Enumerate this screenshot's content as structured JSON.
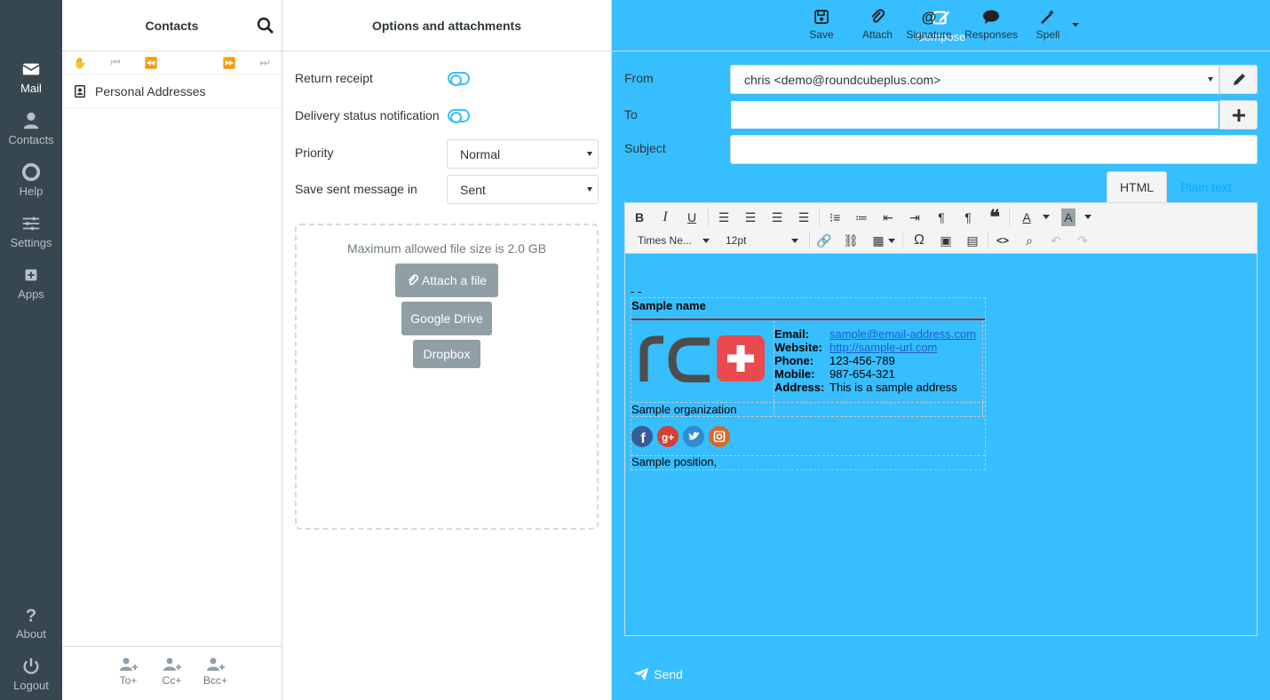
{
  "nav": {
    "compose": "Compose",
    "mail": "Mail",
    "contacts": "Contacts",
    "help": "Help",
    "settings": "Settings",
    "apps": "Apps",
    "about": "About",
    "logout": "Logout"
  },
  "contacts_panel": {
    "title": "Contacts",
    "address_book": "Personal Addresses",
    "to_plus": "To+",
    "cc_plus": "Cc+",
    "bcc_plus": "Bcc+"
  },
  "options": {
    "title": "Options and attachments",
    "return_receipt": "Return receipt",
    "delivery_status": "Delivery status notification",
    "priority_label": "Priority",
    "priority_value": "Normal",
    "save_sent_label": "Save sent message in",
    "save_sent_value": "Sent",
    "max_file_size": "Maximum allowed file size is 2.0 GB",
    "attach_file": "Attach a file",
    "google_drive": "Google Drive",
    "dropbox": "Dropbox"
  },
  "toolbar": {
    "save": "Save",
    "attach": "Attach",
    "signature": "Signature",
    "responses": "Responses",
    "spell": "Spell"
  },
  "headers": {
    "from_label": "From",
    "from_value": "chris <demo@roundcubeplus.com>",
    "to_label": "To",
    "to_value": "",
    "subject_label": "Subject",
    "subject_value": ""
  },
  "editor": {
    "tab_html": "HTML",
    "tab_plain": "Plain text",
    "font_family": "Times Ne...",
    "font_size": "12pt",
    "sig_separator": "- -",
    "sig_name": "Sample name",
    "email_label": "Email:",
    "email_value": "sample@email-address.com",
    "website_label": "Website:",
    "website_value": "http://sample-url.com",
    "phone_label": "Phone:",
    "phone_value": "123-456-789",
    "mobile_label": "Mobile:",
    "mobile_value": "987-654-321",
    "address_label": "Address:",
    "address_value": "This is a sample address",
    "organization": "Sample organization",
    "position": "Sample position,"
  },
  "send": "Send",
  "colors": {
    "accent": "#37beff",
    "nav_bg": "#37474f",
    "gray_button": "#8f9fa5",
    "logo_red": "#e84a4f",
    "logo_gray": "#4d4d4d"
  }
}
